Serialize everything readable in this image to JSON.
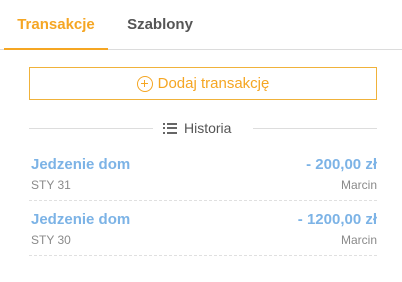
{
  "tabs": [
    {
      "label": "Transakcje",
      "active": true
    },
    {
      "label": "Szablony",
      "active": false
    }
  ],
  "add_button": {
    "label": "Dodaj transakcję",
    "icon": "plus-circle-icon"
  },
  "history": {
    "label": "Historia",
    "icon": "list-icon"
  },
  "transactions": [
    {
      "name": "Jedzenie dom",
      "amount": "- 200,00 zł",
      "date": "STY 31",
      "user": "Marcin"
    },
    {
      "name": "Jedzenie dom",
      "amount": "- 1200,00 zł",
      "date": "STY 30",
      "user": "Marcin"
    }
  ],
  "colors": {
    "accent": "#f5a623",
    "amount": "#7cb3e6",
    "muted": "#8a8a8a"
  }
}
